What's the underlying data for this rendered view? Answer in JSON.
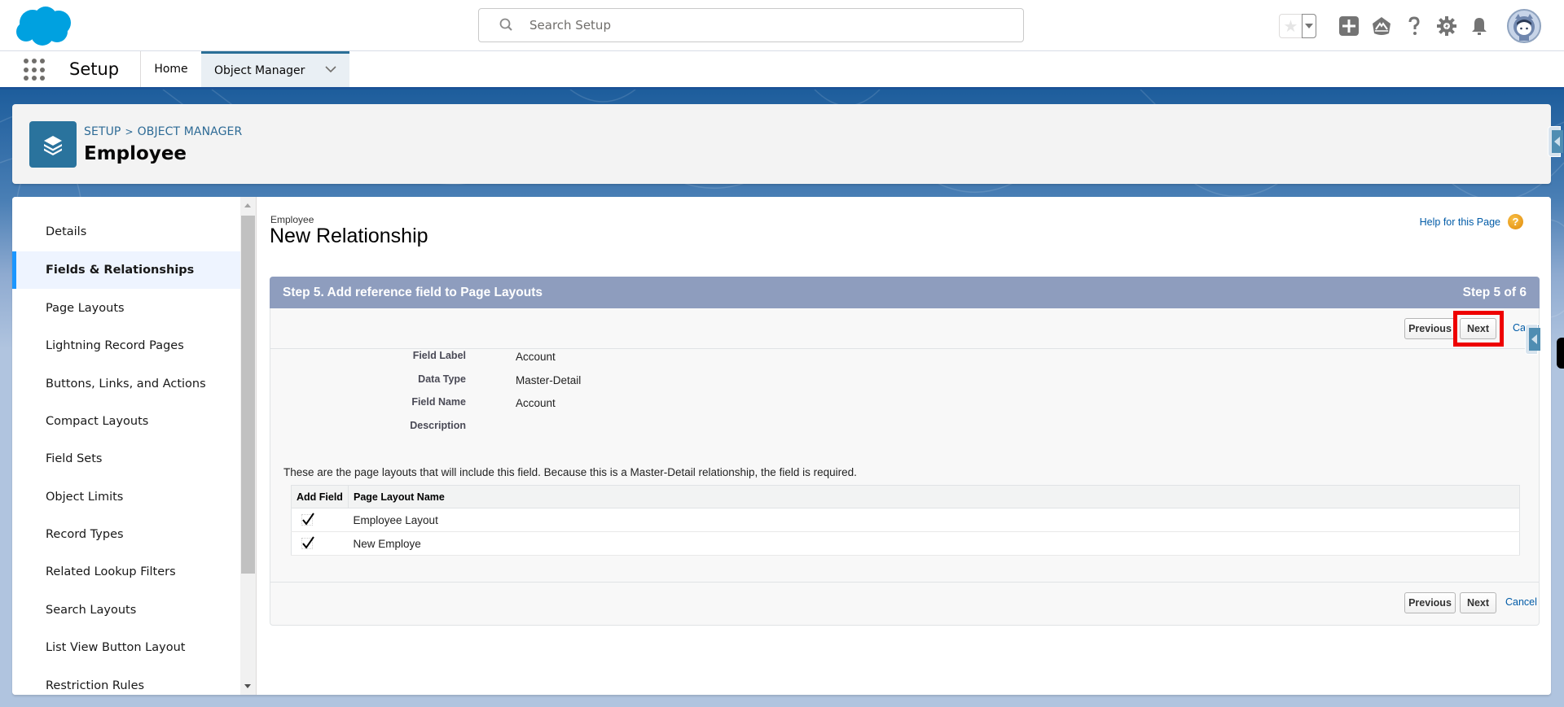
{
  "header": {
    "search_placeholder": "Search Setup",
    "icons": [
      "favorites-star-icon",
      "favorites-dropdown-icon",
      "global-actions-add-icon",
      "trailhead-icon",
      "help-icon",
      "setup-gear-icon",
      "notifications-bell-icon",
      "user-avatar"
    ]
  },
  "nav": {
    "app_name": "Setup",
    "tabs": [
      {
        "label": "Home",
        "active": false
      },
      {
        "label": "Object Manager",
        "active": true
      }
    ]
  },
  "object_header": {
    "breadcrumb": [
      "SETUP",
      "OBJECT MANAGER"
    ],
    "breadcrumb_separator": ">",
    "title": "Employee"
  },
  "sidebar": {
    "items": [
      {
        "label": "Details",
        "active": false
      },
      {
        "label": "Fields & Relationships",
        "active": true
      },
      {
        "label": "Page Layouts",
        "active": false
      },
      {
        "label": "Lightning Record Pages",
        "active": false
      },
      {
        "label": "Buttons, Links, and Actions",
        "active": false
      },
      {
        "label": "Compact Layouts",
        "active": false
      },
      {
        "label": "Field Sets",
        "active": false
      },
      {
        "label": "Object Limits",
        "active": false
      },
      {
        "label": "Record Types",
        "active": false
      },
      {
        "label": "Related Lookup Filters",
        "active": false
      },
      {
        "label": "Search Layouts",
        "active": false
      },
      {
        "label": "List View Button Layout",
        "active": false
      },
      {
        "label": "Restriction Rules",
        "active": false
      }
    ]
  },
  "page": {
    "subtitle": "Employee",
    "title": "New Relationship",
    "help_link": "Help for this Page",
    "help_icon_glyph": "?"
  },
  "wizard": {
    "step_title": "Step 5. Add reference field to Page Layouts",
    "step_counter": "Step 5 of 6",
    "buttons": {
      "previous": "Previous",
      "next": "Next",
      "cancel": "Cancel",
      "cancel_top_truncated": "Cancel"
    },
    "fields": [
      {
        "label": "Field Label",
        "value": "Account"
      },
      {
        "label": "Data Type",
        "value": "Master-Detail"
      },
      {
        "label": "Field Name",
        "value": "Account"
      },
      {
        "label": "Description",
        "value": ""
      }
    ],
    "note": "These are the page layouts that will include this field. Because this is a Master-Detail relationship, the field is required.",
    "table": {
      "columns": [
        "Add Field",
        "Page Layout Name"
      ],
      "rows": [
        {
          "checked": true,
          "name": "Employee Layout"
        },
        {
          "checked": true,
          "name": "New Employe"
        }
      ]
    }
  },
  "colors": {
    "brand_blue": "#00a1e0",
    "step_header": "#8e9dbe",
    "link": "#015ba7",
    "active_tab_accent": "#2a6f97",
    "sidebar_active_bar": "#1b96ff",
    "highlight_box": "#ee0000"
  }
}
